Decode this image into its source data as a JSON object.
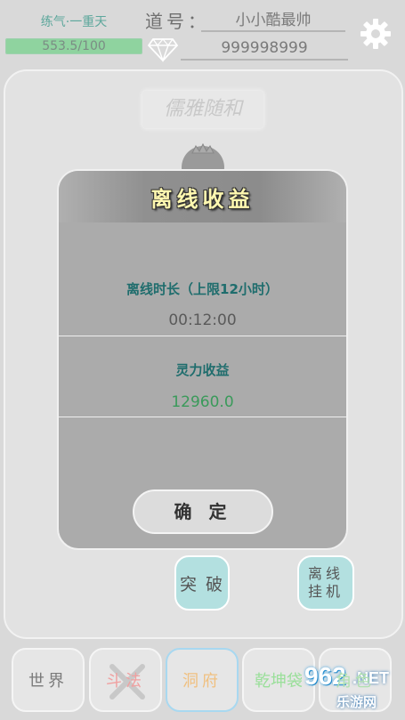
{
  "header": {
    "realm": "练气·一重天",
    "exp_text": "553.5/100",
    "exp_progress": 1.0,
    "daohao_label": "道号：",
    "player_name": "小小酷最帅",
    "gem_count": "999998999",
    "diamond_icon": "diamond-icon",
    "settings_icon": "gear-icon"
  },
  "main": {
    "title": "儒雅随和",
    "breakthrough_label": "突 破",
    "offline_idle_label": "离线挂机"
  },
  "dialog": {
    "title": "离线收益",
    "offline_label": "离线时长（上限12小时）",
    "offline_time": "00:12:00",
    "reward_label": "灵力收益",
    "reward_value": "12960.0",
    "confirm_label": "确 定"
  },
  "tabs": [
    {
      "label": "世界"
    },
    {
      "label": "斗法"
    },
    {
      "label": "洞府"
    },
    {
      "label": "乾坤袋"
    },
    {
      "label": "角色"
    }
  ],
  "watermark": {
    "number": "962",
    "net": ".NET",
    "site": "乐游网"
  },
  "colors": {
    "accent_teal": "#1f6d6d",
    "reward_green": "#3a9a5a",
    "title_yellow": "#fff8b0",
    "button_cyan": "#b3e0e0"
  }
}
